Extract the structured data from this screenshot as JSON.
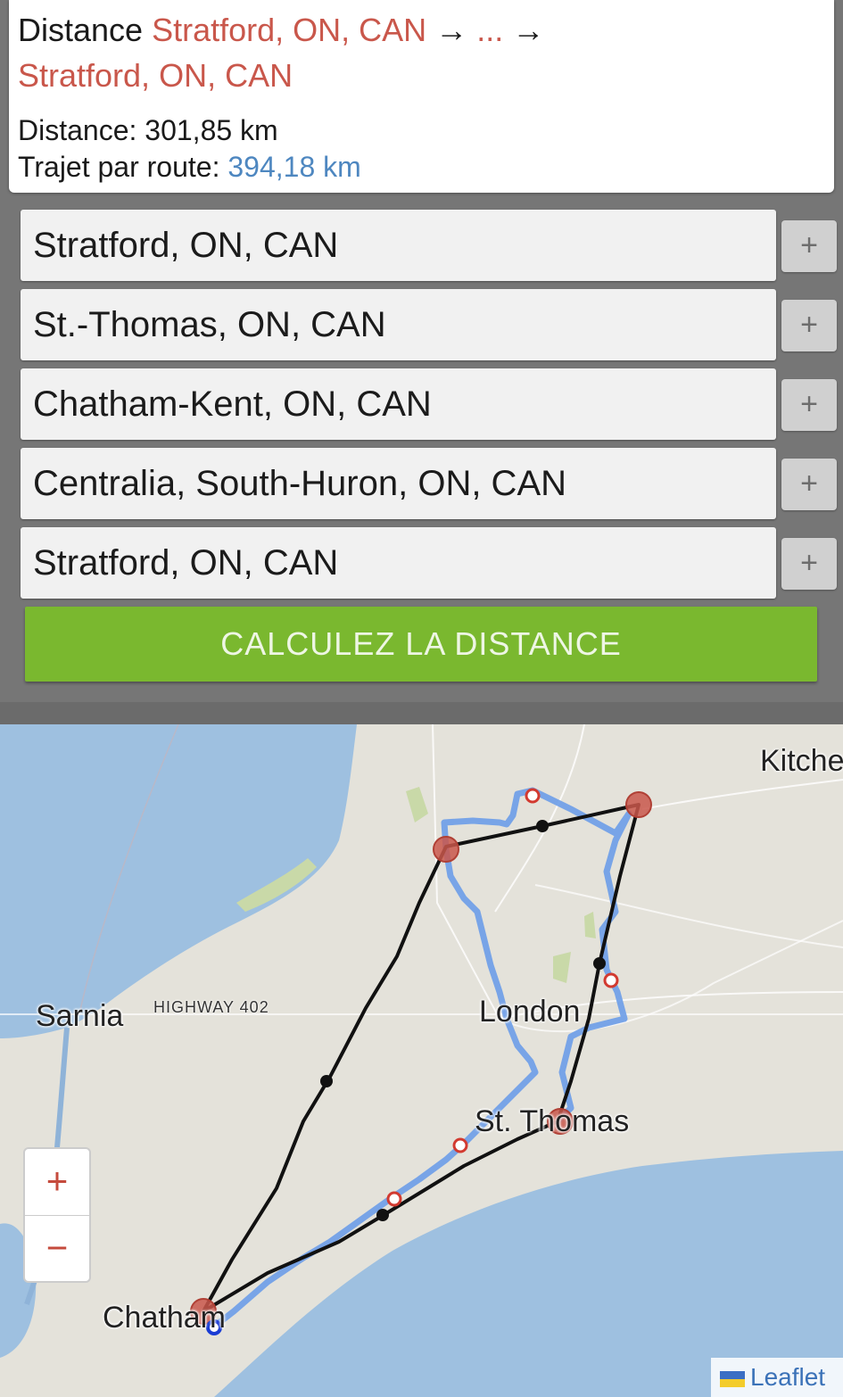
{
  "summary": {
    "distance_prefix": "Distance",
    "route_start": "Stratford, ON, CAN",
    "arrow1": "→",
    "ellipsis": "...",
    "arrow2": "→",
    "route_end": "Stratford, ON, CAN",
    "distance_label": "Distance:",
    "distance_value": "301,85 km",
    "road_label": "Trajet par route:",
    "road_value": "394,18 km"
  },
  "stops": [
    {
      "value": "Stratford, ON, CAN",
      "add": "+"
    },
    {
      "value": "St.-Thomas, ON, CAN",
      "add": "+"
    },
    {
      "value": "Chatham-Kent, ON, CAN",
      "add": "+"
    },
    {
      "value": "Centralia, South-Huron, ON, CAN",
      "add": "+"
    },
    {
      "value": "Stratford, ON, CAN",
      "add": "+"
    }
  ],
  "calculate_button": "CALCULEZ LA DISTANCE",
  "map": {
    "labels": {
      "kitchener": "Kitche",
      "sarnia": "Sarnia",
      "highway": "HIGHWAY 402",
      "london": "London",
      "st_thomas": "St. Thomas",
      "chatham": "Chatham"
    },
    "zoom_in": "+",
    "zoom_out": "−",
    "attribution": "Leaflet",
    "colors": {
      "water": "#9ec0e0",
      "land": "#e4e2da",
      "straight_route": "#111111",
      "road_route": "#6b9de8",
      "marker": "#c9574b"
    }
  }
}
